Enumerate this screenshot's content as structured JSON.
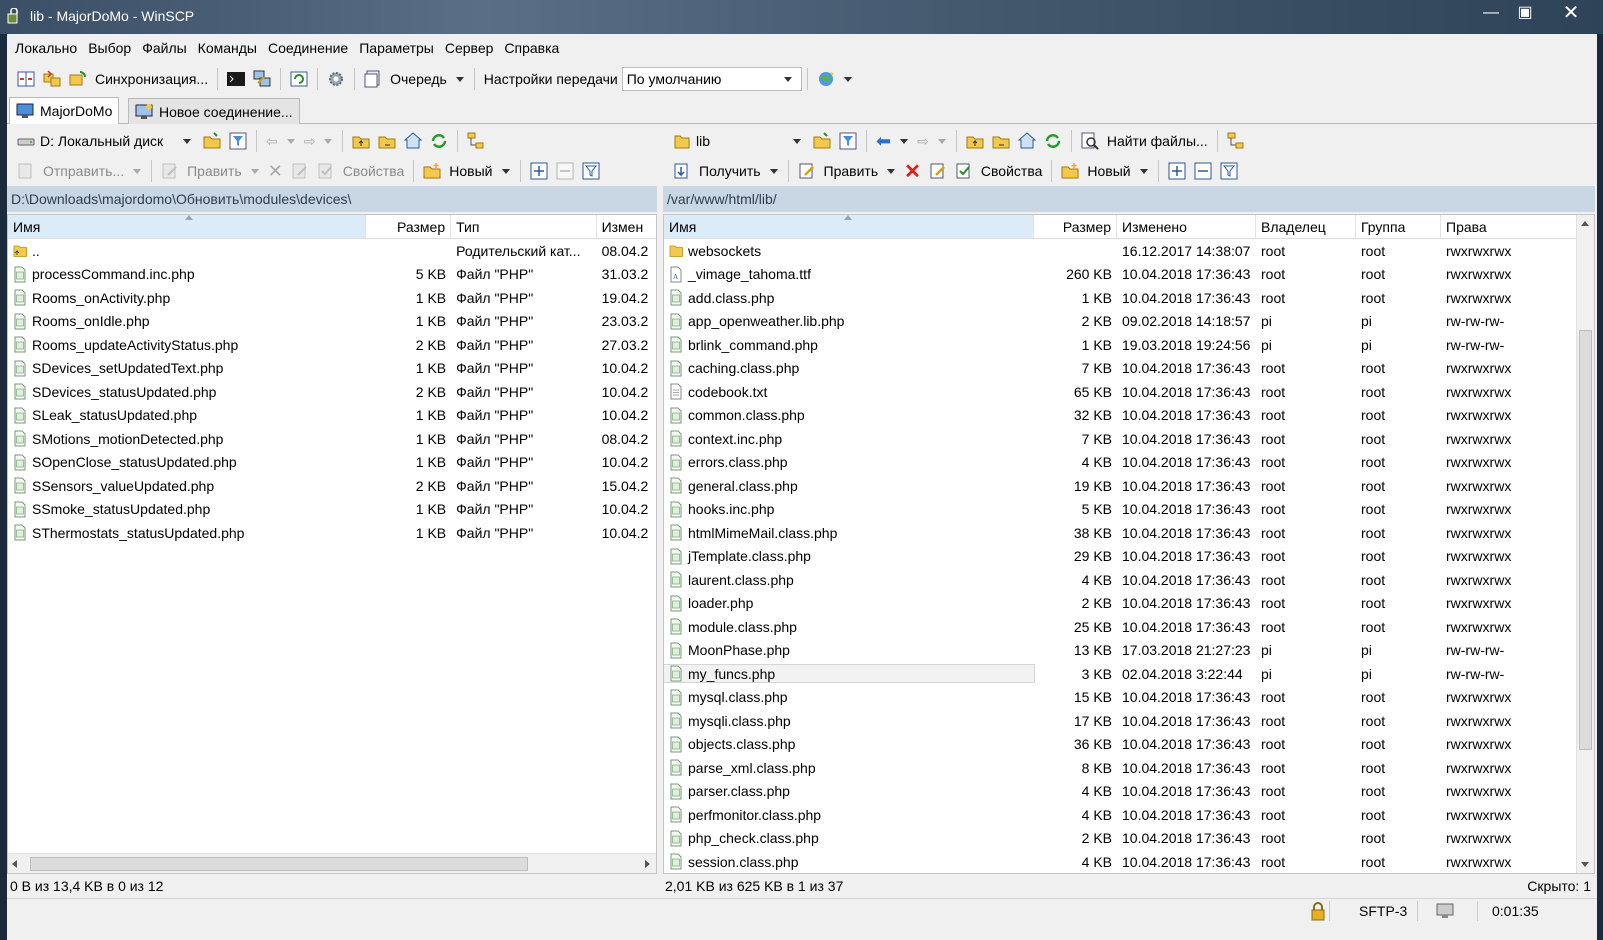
{
  "window": {
    "title": "lib - MajorDoMo - WinSCP",
    "min": "—",
    "max": "▣",
    "close": "✕"
  },
  "menu": [
    "Локально",
    "Выбор",
    "Файлы",
    "Команды",
    "Соединение",
    "Параметры",
    "Сервер",
    "Справка"
  ],
  "toolbar": {
    "sync_label": "Синхронизация...",
    "queue_label": "Очередь",
    "transfer_settings_label": "Настройки передачи",
    "transfer_preset": "По умолчанию"
  },
  "tabs": {
    "session": "MajorDoMo",
    "new_session": "Новое соединение..."
  },
  "left": {
    "drive": "D: Локальный диск",
    "actions": {
      "upload": "Отправить...",
      "edit": "Править",
      "properties": "Свойства",
      "new": "Новый"
    },
    "path": "D:\\Downloads\\majordomo\\Обновить\\modules\\devices\\",
    "columns": {
      "name": "Имя",
      "size": "Размер",
      "type": "Тип",
      "modified": "Измен"
    },
    "files": [
      {
        "name": "..",
        "size": "",
        "type": "Родительский кат...",
        "modified": "08.04.2",
        "icon": "folder-up-icon"
      },
      {
        "name": "processCommand.inc.php",
        "size": "5 KB",
        "type": "Файл \"PHP\"",
        "modified": "31.03.2",
        "icon": "php-file-icon"
      },
      {
        "name": "Rooms_onActivity.php",
        "size": "1 KB",
        "type": "Файл \"PHP\"",
        "modified": "19.04.2",
        "icon": "php-file-icon"
      },
      {
        "name": "Rooms_onIdle.php",
        "size": "1 KB",
        "type": "Файл \"PHP\"",
        "modified": "23.03.2",
        "icon": "php-file-icon"
      },
      {
        "name": "Rooms_updateActivityStatus.php",
        "size": "2 KB",
        "type": "Файл \"PHP\"",
        "modified": "27.03.2",
        "icon": "php-file-icon"
      },
      {
        "name": "SDevices_setUpdatedText.php",
        "size": "1 KB",
        "type": "Файл \"PHP\"",
        "modified": "10.04.2",
        "icon": "php-file-icon"
      },
      {
        "name": "SDevices_statusUpdated.php",
        "size": "2 KB",
        "type": "Файл \"PHP\"",
        "modified": "10.04.2",
        "icon": "php-file-icon"
      },
      {
        "name": "SLeak_statusUpdated.php",
        "size": "1 KB",
        "type": "Файл \"PHP\"",
        "modified": "10.04.2",
        "icon": "php-file-icon"
      },
      {
        "name": "SMotions_motionDetected.php",
        "size": "1 KB",
        "type": "Файл \"PHP\"",
        "modified": "08.04.2",
        "icon": "php-file-icon"
      },
      {
        "name": "SOpenClose_statusUpdated.php",
        "size": "1 KB",
        "type": "Файл \"PHP\"",
        "modified": "10.04.2",
        "icon": "php-file-icon"
      },
      {
        "name": "SSensors_valueUpdated.php",
        "size": "2 KB",
        "type": "Файл \"PHP\"",
        "modified": "15.04.2",
        "icon": "php-file-icon"
      },
      {
        "name": "SSmoke_statusUpdated.php",
        "size": "1 KB",
        "type": "Файл \"PHP\"",
        "modified": "10.04.2",
        "icon": "php-file-icon"
      },
      {
        "name": "SThermostats_statusUpdated.php",
        "size": "1 KB",
        "type": "Файл \"PHP\"",
        "modified": "10.04.2",
        "icon": "php-file-icon"
      }
    ],
    "status": "0 B из 13,4 KB в 0 из 12"
  },
  "right": {
    "drive": "lib",
    "find_label": "Найти файлы...",
    "actions": {
      "download": "Получить",
      "edit": "Править",
      "properties": "Свойства",
      "new": "Новый"
    },
    "path": "/var/www/html/lib/",
    "columns": {
      "name": "Имя",
      "size": "Размер",
      "modified": "Изменено",
      "owner": "Владелец",
      "group": "Группа",
      "rights": "Права"
    },
    "files": [
      {
        "name": "websockets",
        "size": "",
        "modified": "16.12.2017 14:38:07",
        "owner": "root",
        "group": "root",
        "rights": "rwxrwxrwx",
        "icon": "folder-icon"
      },
      {
        "name": "_vimage_tahoma.ttf",
        "size": "260 KB",
        "modified": "10.04.2018 17:36:43",
        "owner": "root",
        "group": "root",
        "rights": "rwxrwxrwx",
        "icon": "font-file-icon"
      },
      {
        "name": "add.class.php",
        "size": "1 KB",
        "modified": "10.04.2018 17:36:43",
        "owner": "root",
        "group": "root",
        "rights": "rwxrwxrwx",
        "icon": "php-file-icon"
      },
      {
        "name": "app_openweather.lib.php",
        "size": "2 KB",
        "modified": "09.02.2018 14:18:57",
        "owner": "pi",
        "group": "pi",
        "rights": "rw-rw-rw-",
        "icon": "php-file-icon"
      },
      {
        "name": "brlink_command.php",
        "size": "1 KB",
        "modified": "19.03.2018 19:24:56",
        "owner": "pi",
        "group": "pi",
        "rights": "rw-rw-rw-",
        "icon": "php-file-icon"
      },
      {
        "name": "caching.class.php",
        "size": "7 KB",
        "modified": "10.04.2018 17:36:43",
        "owner": "root",
        "group": "root",
        "rights": "rwxrwxrwx",
        "icon": "php-file-icon"
      },
      {
        "name": "codebook.txt",
        "size": "65 KB",
        "modified": "10.04.2018 17:36:43",
        "owner": "root",
        "group": "root",
        "rights": "rwxrwxrwx",
        "icon": "text-file-icon"
      },
      {
        "name": "common.class.php",
        "size": "32 KB",
        "modified": "10.04.2018 17:36:43",
        "owner": "root",
        "group": "root",
        "rights": "rwxrwxrwx",
        "icon": "php-file-icon"
      },
      {
        "name": "context.inc.php",
        "size": "7 KB",
        "modified": "10.04.2018 17:36:43",
        "owner": "root",
        "group": "root",
        "rights": "rwxrwxrwx",
        "icon": "php-file-icon"
      },
      {
        "name": "errors.class.php",
        "size": "4 KB",
        "modified": "10.04.2018 17:36:43",
        "owner": "root",
        "group": "root",
        "rights": "rwxrwxrwx",
        "icon": "php-file-icon"
      },
      {
        "name": "general.class.php",
        "size": "19 KB",
        "modified": "10.04.2018 17:36:43",
        "owner": "root",
        "group": "root",
        "rights": "rwxrwxrwx",
        "icon": "php-file-icon"
      },
      {
        "name": "hooks.inc.php",
        "size": "5 KB",
        "modified": "10.04.2018 17:36:43",
        "owner": "root",
        "group": "root",
        "rights": "rwxrwxrwx",
        "icon": "php-file-icon"
      },
      {
        "name": "htmlMimeMail.class.php",
        "size": "38 KB",
        "modified": "10.04.2018 17:36:43",
        "owner": "root",
        "group": "root",
        "rights": "rwxrwxrwx",
        "icon": "php-file-icon"
      },
      {
        "name": "jTemplate.class.php",
        "size": "29 KB",
        "modified": "10.04.2018 17:36:43",
        "owner": "root",
        "group": "root",
        "rights": "rwxrwxrwx",
        "icon": "php-file-icon"
      },
      {
        "name": "laurent.class.php",
        "size": "4 KB",
        "modified": "10.04.2018 17:36:43",
        "owner": "root",
        "group": "root",
        "rights": "rwxrwxrwx",
        "icon": "php-file-icon"
      },
      {
        "name": "loader.php",
        "size": "2 KB",
        "modified": "10.04.2018 17:36:43",
        "owner": "root",
        "group": "root",
        "rights": "rwxrwxrwx",
        "icon": "php-file-icon"
      },
      {
        "name": "module.class.php",
        "size": "25 KB",
        "modified": "10.04.2018 17:36:43",
        "owner": "root",
        "group": "root",
        "rights": "rwxrwxrwx",
        "icon": "php-file-icon"
      },
      {
        "name": "MoonPhase.php",
        "size": "13 KB",
        "modified": "17.03.2018 21:27:23",
        "owner": "pi",
        "group": "pi",
        "rights": "rw-rw-rw-",
        "icon": "php-file-icon"
      },
      {
        "name": "my_funcs.php",
        "size": "3 KB",
        "modified": "02.04.2018 3:22:44",
        "owner": "pi",
        "group": "pi",
        "rights": "rw-rw-rw-",
        "icon": "php-file-icon",
        "selected": true
      },
      {
        "name": "mysql.class.php",
        "size": "15 KB",
        "modified": "10.04.2018 17:36:43",
        "owner": "root",
        "group": "root",
        "rights": "rwxrwxrwx",
        "icon": "php-file-icon"
      },
      {
        "name": "mysqli.class.php",
        "size": "17 KB",
        "modified": "10.04.2018 17:36:43",
        "owner": "root",
        "group": "root",
        "rights": "rwxrwxrwx",
        "icon": "php-file-icon"
      },
      {
        "name": "objects.class.php",
        "size": "36 KB",
        "modified": "10.04.2018 17:36:43",
        "owner": "root",
        "group": "root",
        "rights": "rwxrwxrwx",
        "icon": "php-file-icon"
      },
      {
        "name": "parse_xml.class.php",
        "size": "8 KB",
        "modified": "10.04.2018 17:36:43",
        "owner": "root",
        "group": "root",
        "rights": "rwxrwxrwx",
        "icon": "php-file-icon"
      },
      {
        "name": "parser.class.php",
        "size": "4 KB",
        "modified": "10.04.2018 17:36:43",
        "owner": "root",
        "group": "root",
        "rights": "rwxrwxrwx",
        "icon": "php-file-icon"
      },
      {
        "name": "perfmonitor.class.php",
        "size": "4 KB",
        "modified": "10.04.2018 17:36:43",
        "owner": "root",
        "group": "root",
        "rights": "rwxrwxrwx",
        "icon": "php-file-icon"
      },
      {
        "name": "php_check.class.php",
        "size": "2 KB",
        "modified": "10.04.2018 17:36:43",
        "owner": "root",
        "group": "root",
        "rights": "rwxrwxrwx",
        "icon": "php-file-icon"
      },
      {
        "name": "session.class.php",
        "size": "4 KB",
        "modified": "10.04.2018 17:36:43",
        "owner": "root",
        "group": "root",
        "rights": "rwxrwxrwx",
        "icon": "php-file-icon"
      }
    ],
    "status": "2,01 KB из 625 KB в 1 из 37",
    "hidden": "Скрыто: 1"
  },
  "statusbar": {
    "protocol": "SFTP-3",
    "elapsed": "0:01:35"
  },
  "colors": {
    "path_bar": "#c9d7e5",
    "sorted_header": "#dcebf8",
    "delete_red": "#d9211a",
    "folder": "#f2c94c",
    "nav_blue": "#2a6fd0"
  }
}
